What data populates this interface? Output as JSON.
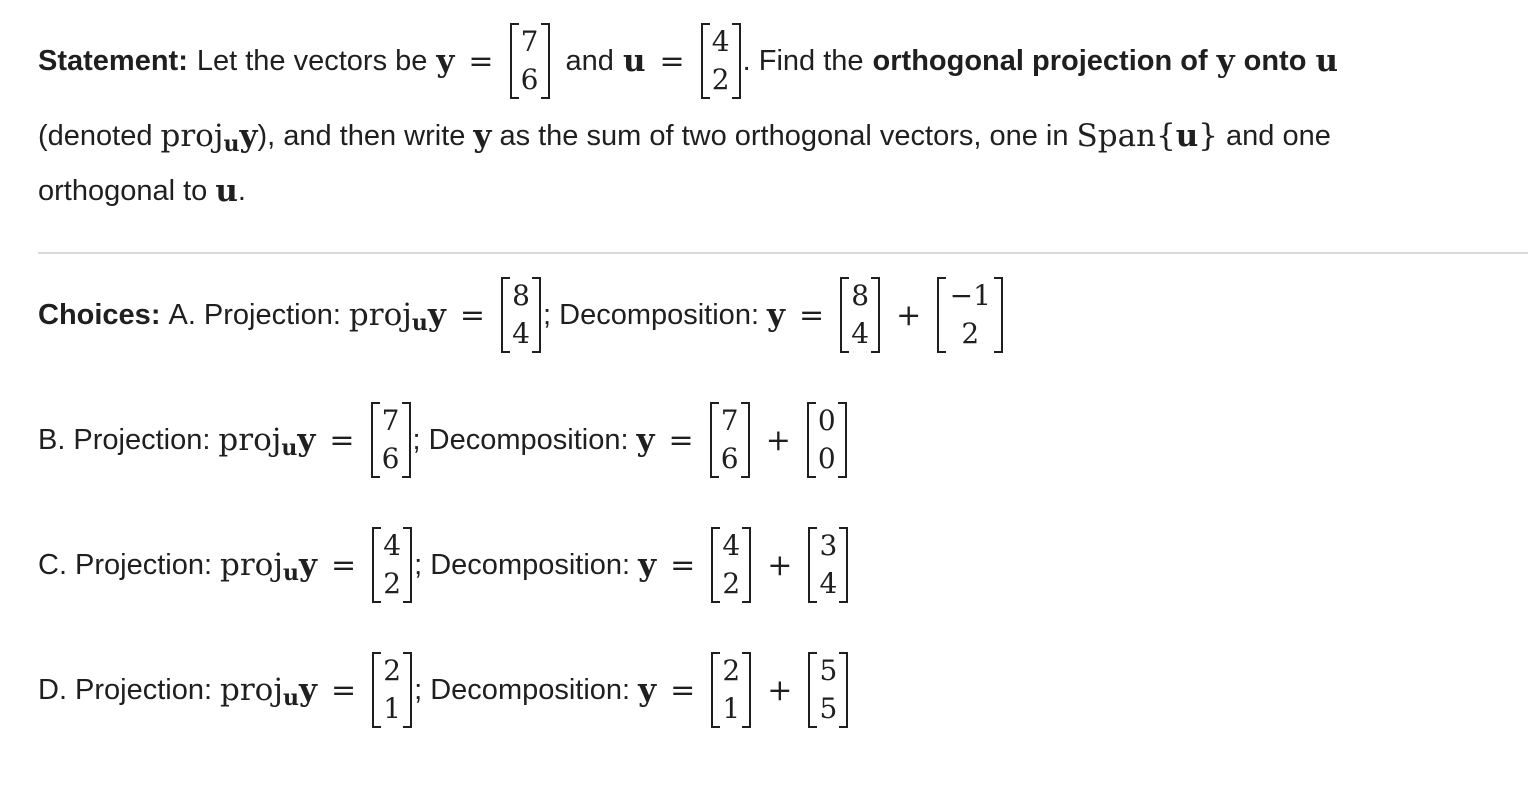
{
  "statement": {
    "label": "Statement:",
    "text1": "Let the vectors be",
    "y": "y",
    "equals": "=",
    "y_vector": [
      "7",
      "6"
    ],
    "and": "and",
    "u": "u",
    "u_vector": [
      "4",
      "2"
    ],
    "find_prefix": ". Find the",
    "find_bold": "orthogonal projection of",
    "onto": "onto",
    "denoted_open": "(denoted",
    "proj": "proj",
    "denoted_close": "), and then write",
    "as_sum": "as the sum of two orthogonal vectors, one in",
    "span": "Span",
    "brace_open": "{",
    "brace_close": "}",
    "and_one": "and one",
    "orthogonal_to": "orthogonal to",
    "period": "."
  },
  "choices": {
    "label": "Choices:",
    "projection_label": "Projection:",
    "decomposition_label": "; Decomposition:",
    "proj": "proj",
    "u": "u",
    "y": "y",
    "equals": "=",
    "plus": "+",
    "items": [
      {
        "letter": "A.",
        "projection": [
          "8",
          "4"
        ],
        "part1": [
          "8",
          "4"
        ],
        "part2": [
          "−1",
          "2"
        ]
      },
      {
        "letter": "B.",
        "projection": [
          "7",
          "6"
        ],
        "part1": [
          "7",
          "6"
        ],
        "part2": [
          "0",
          "0"
        ]
      },
      {
        "letter": "C.",
        "projection": [
          "4",
          "2"
        ],
        "part1": [
          "4",
          "2"
        ],
        "part2": [
          "3",
          "4"
        ]
      },
      {
        "letter": "D.",
        "projection": [
          "2",
          "1"
        ],
        "part1": [
          "2",
          "1"
        ],
        "part2": [
          "5",
          "5"
        ]
      }
    ]
  }
}
